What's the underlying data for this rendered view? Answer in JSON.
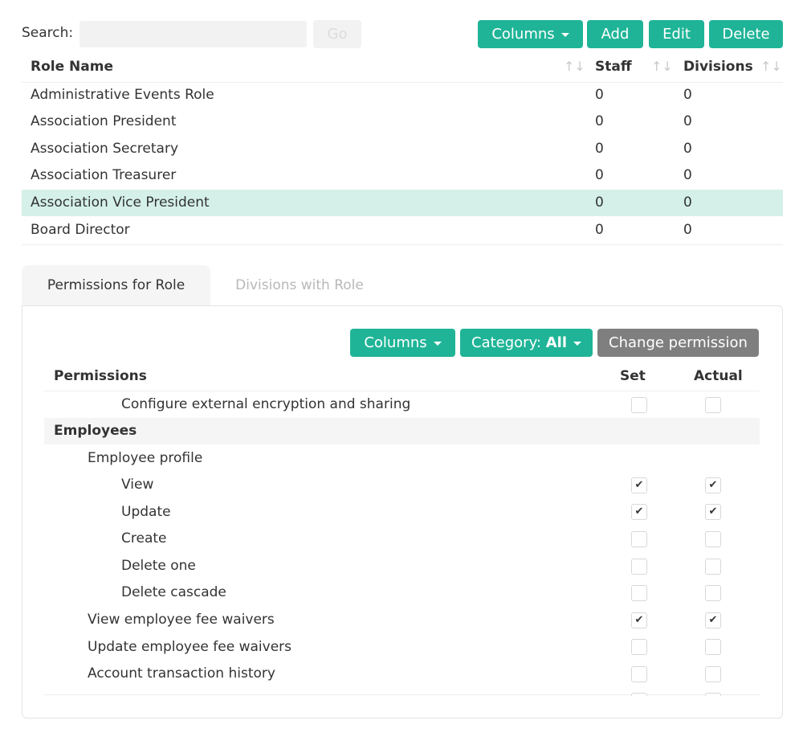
{
  "search": {
    "label": "Search:",
    "value": "",
    "placeholder": "",
    "go_label": "Go"
  },
  "toolbar": {
    "columns_label": "Columns",
    "add_label": "Add",
    "edit_label": "Edit",
    "delete_label": "Delete"
  },
  "roles_table": {
    "headers": {
      "name": "Role Name",
      "staff": "Staff",
      "divisions": "Divisions"
    },
    "sort_glyph": "↑↓",
    "rows": [
      {
        "name": "Administrative Events Role",
        "staff": "0",
        "divisions": "0"
      },
      {
        "name": "Association President",
        "staff": "0",
        "divisions": "0"
      },
      {
        "name": "Association Secretary",
        "staff": "0",
        "divisions": "0"
      },
      {
        "name": "Association Treasurer",
        "staff": "0",
        "divisions": "0"
      },
      {
        "name": "Association Vice President",
        "staff": "0",
        "divisions": "0"
      },
      {
        "name": "Board Director",
        "staff": "0",
        "divisions": "0"
      }
    ],
    "selected_row": "Association Vice President"
  },
  "tabs": {
    "permissions": "Permissions for Role",
    "divisions": "Divisions with Role"
  },
  "perm_toolbar": {
    "columns_label": "Columns",
    "category_prefix": "Category:",
    "category_value": "All",
    "change_label": "Change permission"
  },
  "perm_table": {
    "headers": {
      "permissions": "Permissions",
      "set": "Set",
      "actual": "Actual"
    },
    "rows": [
      {
        "label": "Configure external encryption and sharing",
        "level": 2,
        "set": false,
        "actual": false
      },
      {
        "label": "Employees",
        "level": 0,
        "group": true
      },
      {
        "label": "Employee profile",
        "level": 1
      },
      {
        "label": "View",
        "level": 2,
        "set": true,
        "actual": true
      },
      {
        "label": "Update",
        "level": 2,
        "set": true,
        "actual": true
      },
      {
        "label": "Create",
        "level": 2,
        "set": false,
        "actual": false
      },
      {
        "label": "Delete one",
        "level": 2,
        "set": false,
        "actual": false
      },
      {
        "label": "Delete cascade",
        "level": 2,
        "set": false,
        "actual": false
      },
      {
        "label": "View employee fee waivers",
        "level": 1,
        "set": true,
        "actual": true
      },
      {
        "label": "Update employee fee waivers",
        "level": 1,
        "set": false,
        "actual": false
      },
      {
        "label": "Account transaction history",
        "level": 1,
        "set": false,
        "actual": false
      }
    ]
  },
  "colors": {
    "accent": "#1fb497",
    "selected_row": "#d4f0e9",
    "grey_button": "#7f7f7f"
  },
  "icons": {
    "caret": "caret-down-icon",
    "check": "check-icon",
    "sort": "sort-icon"
  }
}
